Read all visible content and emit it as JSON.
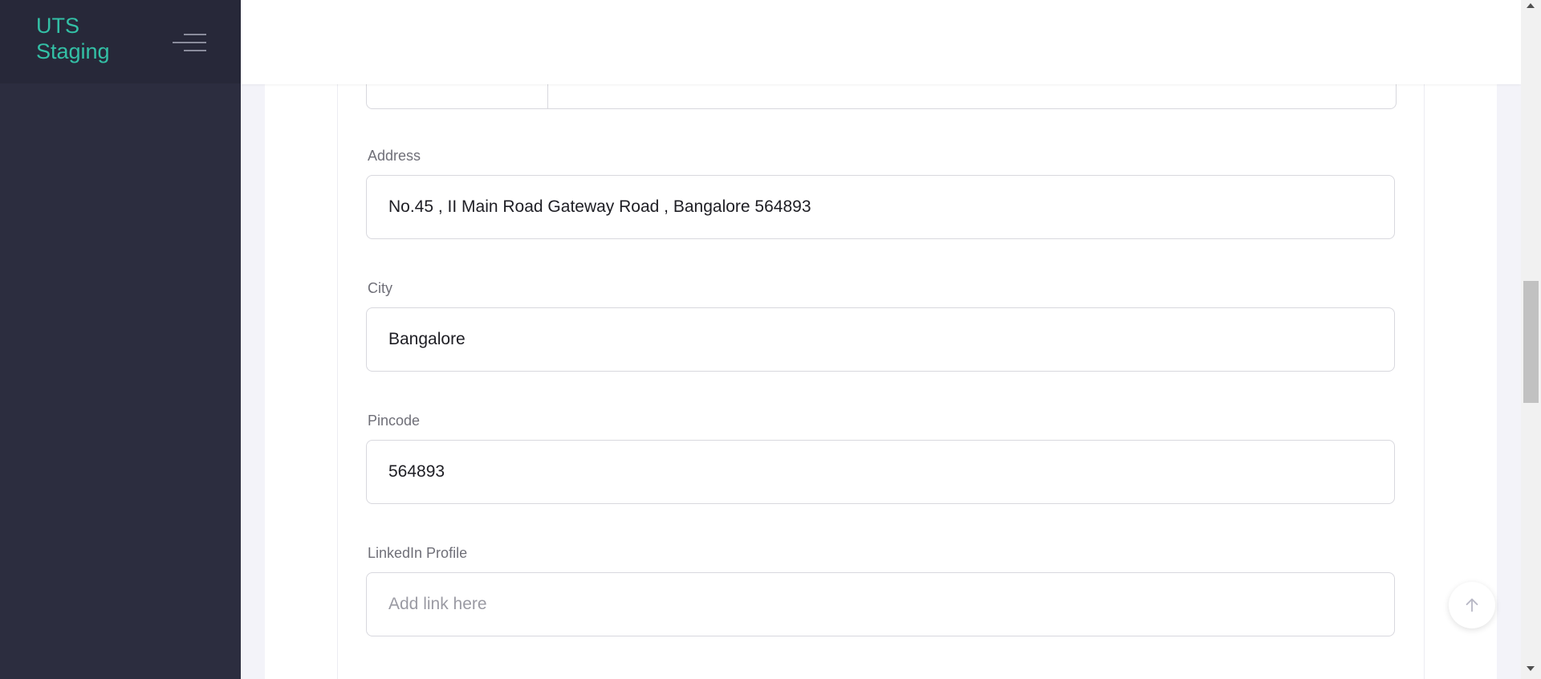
{
  "brand": {
    "line1": "UTS",
    "line2": "Staging",
    "color": "#33c0a6"
  },
  "sidebar": {
    "toggle_icon": "hamburger-menu-icon"
  },
  "form": {
    "address": {
      "label": "Address",
      "value": "No.45 , II Main Road Gateway Road , Bangalore 564893"
    },
    "city": {
      "label": "City",
      "value": "Bangalore"
    },
    "pincode": {
      "label": "Pincode",
      "value": "564893"
    },
    "linkedin": {
      "label": "LinkedIn Profile",
      "value": "",
      "placeholder": "Add link here"
    }
  },
  "scroll_top": {
    "icon": "arrow-up-icon"
  }
}
